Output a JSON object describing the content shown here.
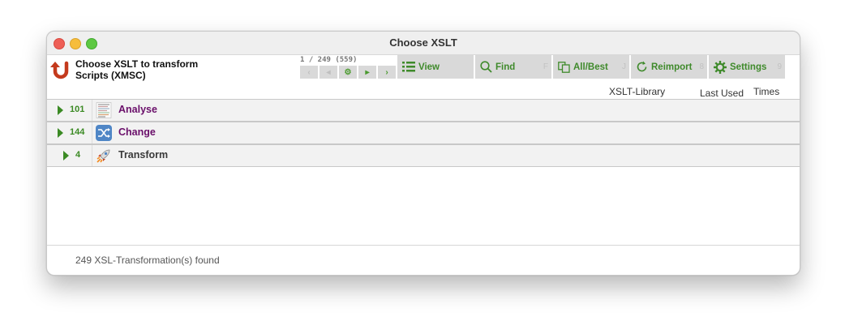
{
  "window": {
    "title": "Choose XSLT"
  },
  "header": {
    "line1": "Choose XSLT to transform",
    "line2": "Scripts (XMSC)",
    "counter": "1 / 249 (559)"
  },
  "toolbar": {
    "view": {
      "label": "View",
      "key": ""
    },
    "find": {
      "label": "Find",
      "key": "F"
    },
    "allbest": {
      "label": "All/Best",
      "key": "J"
    },
    "reimport": {
      "label": "Reimport",
      "key": "8"
    },
    "settings": {
      "label": "Settings",
      "key": "9"
    }
  },
  "columns": {
    "library": "XSLT-Library",
    "last_used": "Last Used",
    "times": "Times"
  },
  "groups": [
    {
      "count": "101",
      "label": "Analyse",
      "color": "#6a0f6a"
    },
    {
      "count": "144",
      "label": "Change",
      "color": "#6a0f6a"
    },
    {
      "count": "4",
      "label": "Transform",
      "color": "#3a3a3a"
    }
  ],
  "status": "249 XSL-Transformation(s) found",
  "colors": {
    "accent_green": "#3b8a24",
    "group_purple": "#6a0f6a"
  }
}
